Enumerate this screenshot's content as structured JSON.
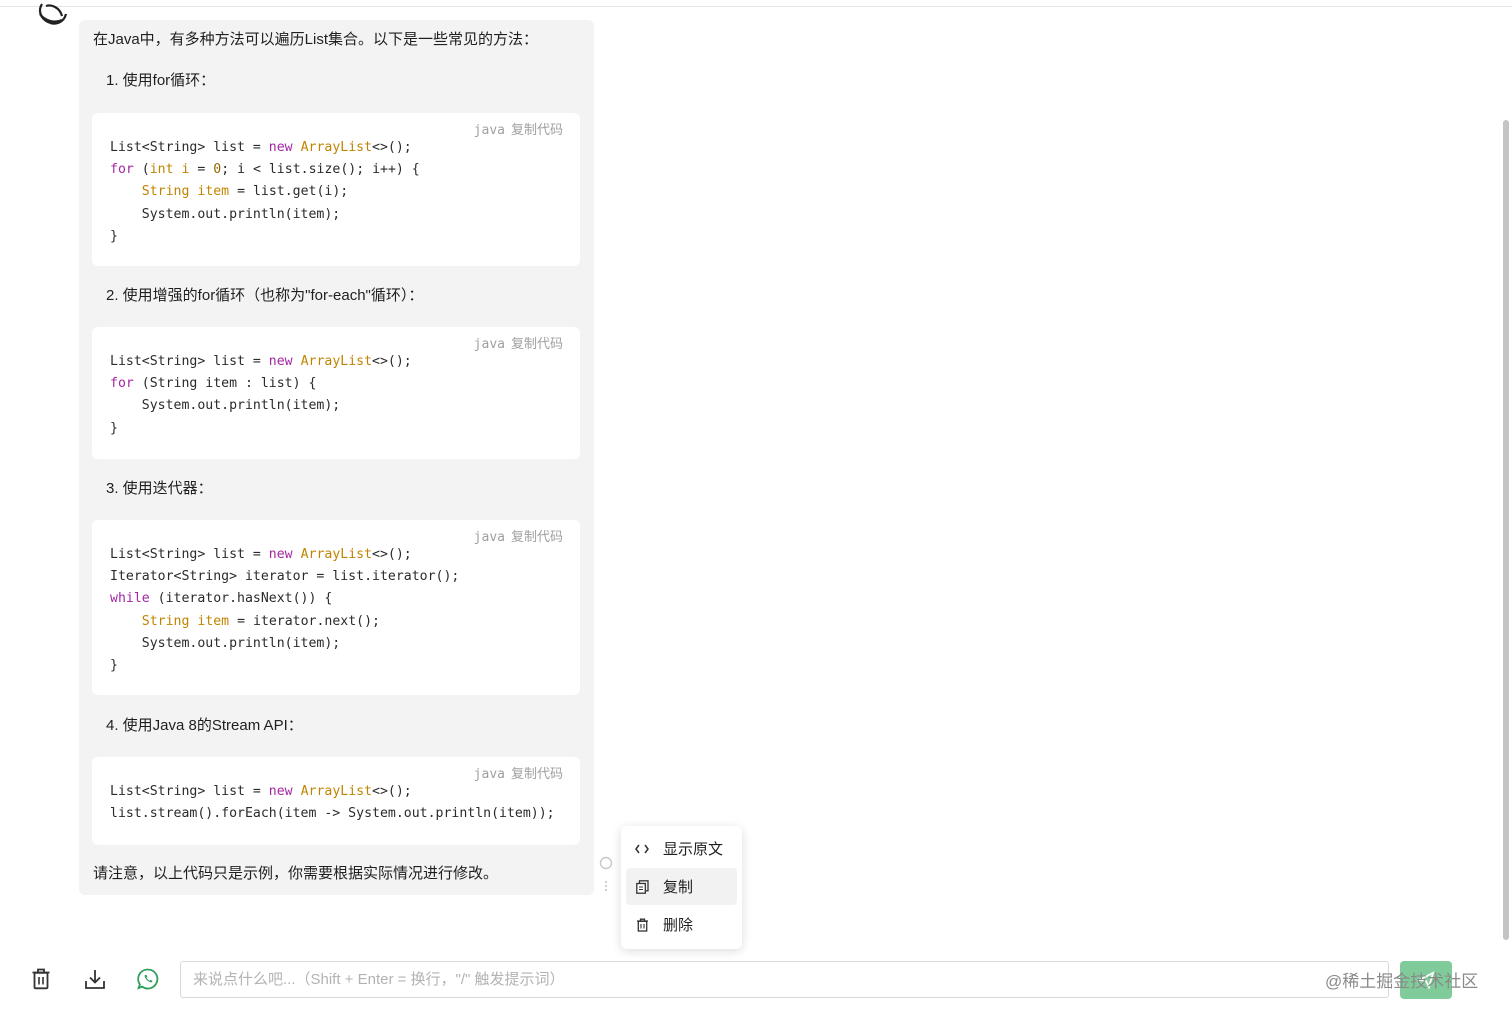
{
  "message": {
    "intro": "在Java中，有多种方法可以遍历List集合。以下是一些常见的方法：",
    "steps": [
      "1. 使用for循环：",
      "2. 使用增强的for循环（也称为\"for-each\"循环）：",
      "3. 使用迭代器：",
      "4. 使用Java 8的Stream API："
    ],
    "code_lang": "java",
    "copy_code_label": "复制代码",
    "outro": "请注意，以上代码只是示例，你需要根据实际情况进行修改。"
  },
  "context_menu": {
    "items": [
      {
        "label": "显示原文",
        "icon": "code-icon"
      },
      {
        "label": "复制",
        "icon": "copy-icon"
      },
      {
        "label": "删除",
        "icon": "trash-icon"
      }
    ]
  },
  "composer": {
    "placeholder": "来说点什么吧...（Shift + Enter = 换行，\"/\" 触发提示词）",
    "actions": [
      "trash-icon",
      "download-icon",
      "whatsapp-icon"
    ],
    "send_icon": "send-icon"
  },
  "watermark": "@稀土掘金技术社区",
  "colors": {
    "accent": "#7fcc9a",
    "keyword": "#a626a4",
    "type": "#c18401",
    "bubble": "#f3f3f3"
  }
}
